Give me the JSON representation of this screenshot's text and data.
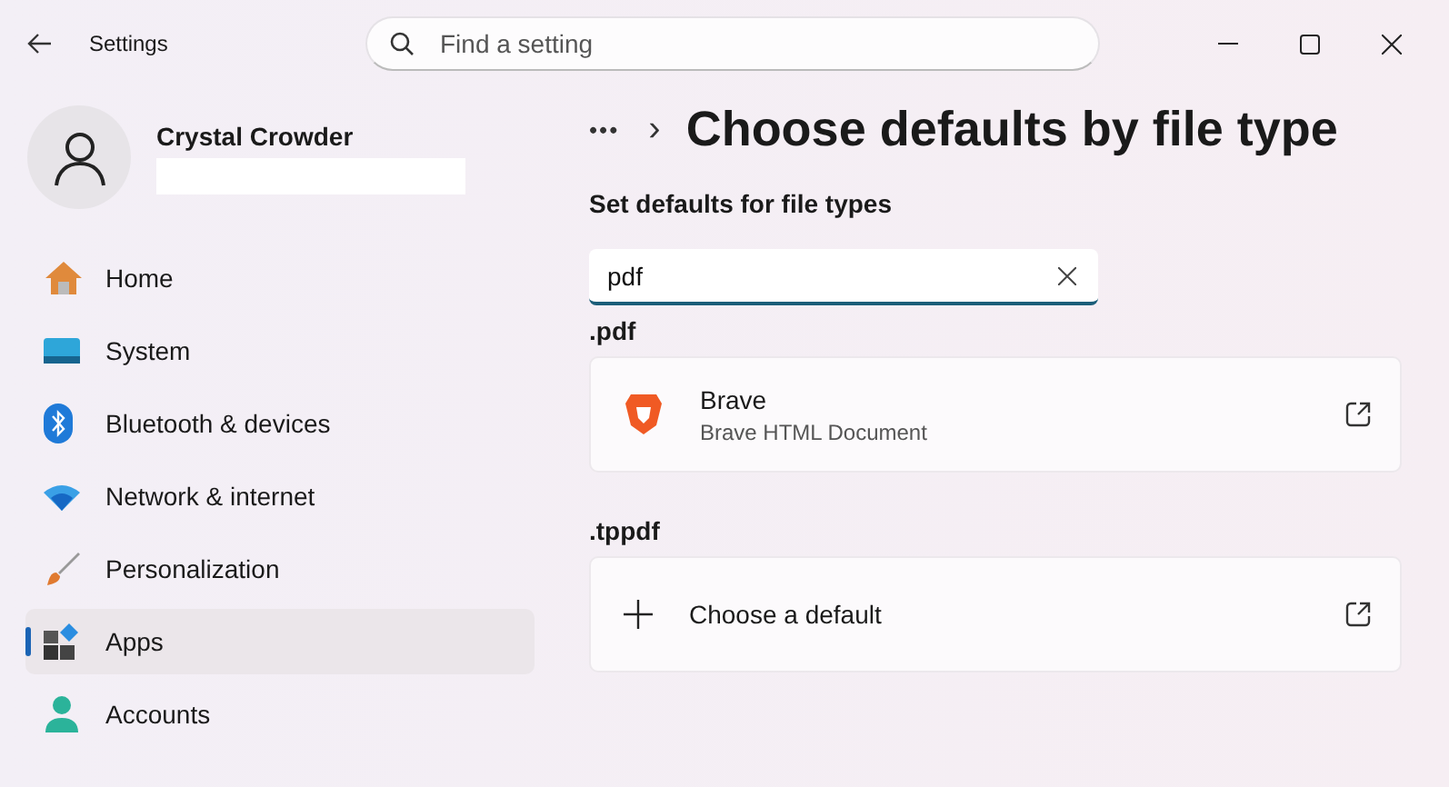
{
  "window": {
    "title": "Settings"
  },
  "search": {
    "placeholder": "Find a setting"
  },
  "user": {
    "name": "Crystal Crowder"
  },
  "sidebar": {
    "items": [
      {
        "label": "Home",
        "kind": "home",
        "selected": false
      },
      {
        "label": "System",
        "kind": "system",
        "selected": false
      },
      {
        "label": "Bluetooth & devices",
        "kind": "bluetooth",
        "selected": false
      },
      {
        "label": "Network & internet",
        "kind": "network",
        "selected": false
      },
      {
        "label": "Personalization",
        "kind": "personalization",
        "selected": false
      },
      {
        "label": "Apps",
        "kind": "apps",
        "selected": true
      },
      {
        "label": "Accounts",
        "kind": "accounts",
        "selected": false
      }
    ]
  },
  "breadcrumb": {
    "more": "•••",
    "separator": "›",
    "title": "Choose defaults by file type"
  },
  "section_title": "Set defaults for file types",
  "filter": {
    "value": "pdf"
  },
  "associations": [
    {
      "extension": ".pdf",
      "kind": "app",
      "name": "Brave",
      "description": "Brave HTML Document"
    },
    {
      "extension": ".tppdf",
      "kind": "choose",
      "name": "Choose a default"
    }
  ]
}
